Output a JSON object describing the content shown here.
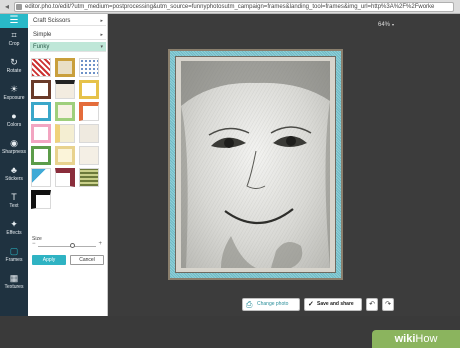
{
  "browser": {
    "url": "editor.pho.to/edit/?utm_medium=postprocessing&utm_source=funnyphotosutm_campaign=frames&landing_tool=frames&img_url=http%3A%2F%2Fworke"
  },
  "toolbar": {
    "items": [
      {
        "label": "Crop",
        "icon": "crop-icon",
        "glyph": "⌗"
      },
      {
        "label": "Rotate",
        "icon": "rotate-icon",
        "glyph": "↻"
      },
      {
        "label": "Exposure",
        "icon": "exposure-icon",
        "glyph": "☀"
      },
      {
        "label": "Colors",
        "icon": "colors-icon",
        "glyph": "●"
      },
      {
        "label": "Sharpness",
        "icon": "sharpness-icon",
        "glyph": "◉"
      },
      {
        "label": "Stickers",
        "icon": "stickers-icon",
        "glyph": "♣"
      },
      {
        "label": "Text",
        "icon": "text-icon",
        "glyph": "T"
      },
      {
        "label": "Effects",
        "icon": "effects-icon",
        "glyph": "✦"
      },
      {
        "label": "Frames",
        "icon": "frames-icon",
        "glyph": "▢"
      },
      {
        "label": "Textures",
        "icon": "textures-icon",
        "glyph": "▦"
      }
    ],
    "active": "Frames"
  },
  "panel": {
    "categories": [
      {
        "label": "Craft Scissors",
        "chevron": "▸"
      },
      {
        "label": "Simple",
        "chevron": "▸"
      },
      {
        "label": "Funky",
        "chevron": "▾"
      }
    ],
    "size_label": "Size",
    "size_value": 0.6,
    "apply_label": "Apply",
    "cancel_label": "Cancel"
  },
  "canvas": {
    "zoom": "64%"
  },
  "actions": {
    "change_photo_label": "Change photo",
    "save_label": "Save and share"
  },
  "watermark": {
    "brand_bold": "wiki",
    "brand_light": "How"
  },
  "colors": {
    "accent": "#29b9c8",
    "toolbar_bg": "#1f3240",
    "frame_teal": "#70b9c4",
    "funky_selected": "#bfe7d8"
  }
}
